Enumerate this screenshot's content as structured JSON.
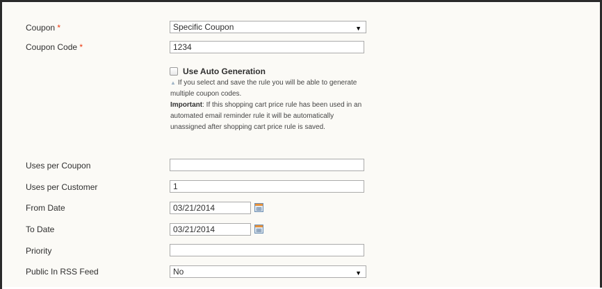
{
  "form": {
    "coupon": {
      "label": "Coupon",
      "required_mark": "*",
      "value": "Specific Coupon",
      "arrow": "▼"
    },
    "coupon_code": {
      "label": "Coupon Code",
      "required_mark": "*",
      "value": "1234"
    },
    "auto_generation": {
      "label": "Use Auto Generation",
      "checked": false,
      "note_text": "If you select and save the rule you will be able to generate multiple coupon codes.",
      "note_important_label": "Important",
      "note_important_text": ": If this shopping cart price rule has been used in an automated email reminder rule it will be automatically unassigned after shopping cart price rule is saved."
    },
    "uses_per_coupon": {
      "label": "Uses per Coupon",
      "value": ""
    },
    "uses_per_customer": {
      "label": "Uses per Customer",
      "value": "1"
    },
    "from_date": {
      "label": "From Date",
      "value": "03/21/2014",
      "icon": "calendar-icon"
    },
    "to_date": {
      "label": "To Date",
      "value": "03/21/2014",
      "icon": "calendar-icon"
    },
    "priority": {
      "label": "Priority",
      "value": ""
    },
    "public_in_rss_feed": {
      "label": "Public In RSS Feed",
      "value": "No",
      "arrow": "▼"
    }
  },
  "colors": {
    "required": "#eb340a",
    "background": "#fbfaf6",
    "input_border": "#aaaaaa"
  }
}
